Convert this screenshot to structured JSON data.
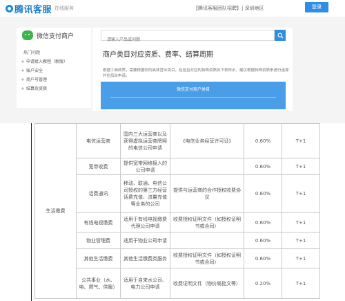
{
  "header": {
    "logo_text": "腾讯客服",
    "logo_sub": "在线服务",
    "top_links": "【腾讯客服团队招聘】| 深圳地区",
    "login_label": "登录"
  },
  "sidebar": {
    "brand": "微信支付商户",
    "items": [
      {
        "label": "热门问题",
        "expandable": false
      },
      {
        "label": "申请接入教程（新版）",
        "expandable": true
      },
      {
        "label": "账户安全",
        "expandable": true
      },
      {
        "label": "商户号管理",
        "expandable": true
      },
      {
        "label": "结算及资质",
        "expandable": true
      }
    ]
  },
  "search": {
    "placeholder": "请输入产品或问题"
  },
  "main": {
    "title": "商户类目对应资质、费率、结算周期",
    "description": "根据工商政策，需要根据你的具体营业类目，包括且对应的特殊资质如下表所示，建议根据特殊资质来进行选择并在后台申请。",
    "blue_box_label": "微信支付商户类目"
  },
  "table": {
    "group_label": "生活缴费",
    "rows": [
      {
        "c2": "电信运营商",
        "c3": "国内三大运营商以及获得虚拟运营商牌照的电信公司申请",
        "c4": "《电信业务经营许可证》",
        "c5": "0.60%",
        "c6": "T+1"
      },
      {
        "c2": "宽带收费",
        "c3": "提供宽带网络接入的公司申请",
        "c4": "",
        "c5": "0.60%",
        "c6": "T+1"
      },
      {
        "c2": "话费通讯",
        "c3": "移动、联通、电信公司授权的第三方经营话费充值、流量充值等业务的公司",
        "c4": "提供与运营商的合作授权收费协议",
        "c5": "0.60%",
        "c6": "T+1"
      },
      {
        "c2": "有线电视缴费",
        "c3": "适用于有线电视缴费代理公司申请",
        "c4": "收费授权证明文件（如授权证明书或合同）",
        "c5": "0.60%",
        "c6": "T+1"
      },
      {
        "c2": "物业管理费",
        "c3": "适用于物业公司申请",
        "c4": "",
        "c5": "0.60%",
        "c6": "T+1"
      },
      {
        "c2": "其他生活缴费",
        "c3": "其他生活缴费类服务",
        "c4": "收费授权证明文件（如授权证明书或合同）",
        "c5": "0.60%",
        "c6": "T+1"
      },
      {
        "c2": "公共事业（水、电、燃气、供暖）",
        "c3": "适用于自来水公司、电力公司申请",
        "c4": "收费证明文件（物价局批文等）",
        "c5": "0.20%",
        "c6": "T+1"
      }
    ]
  },
  "colors": {
    "accent": "#2f8de4",
    "wechat_green": "#3fb44a"
  }
}
